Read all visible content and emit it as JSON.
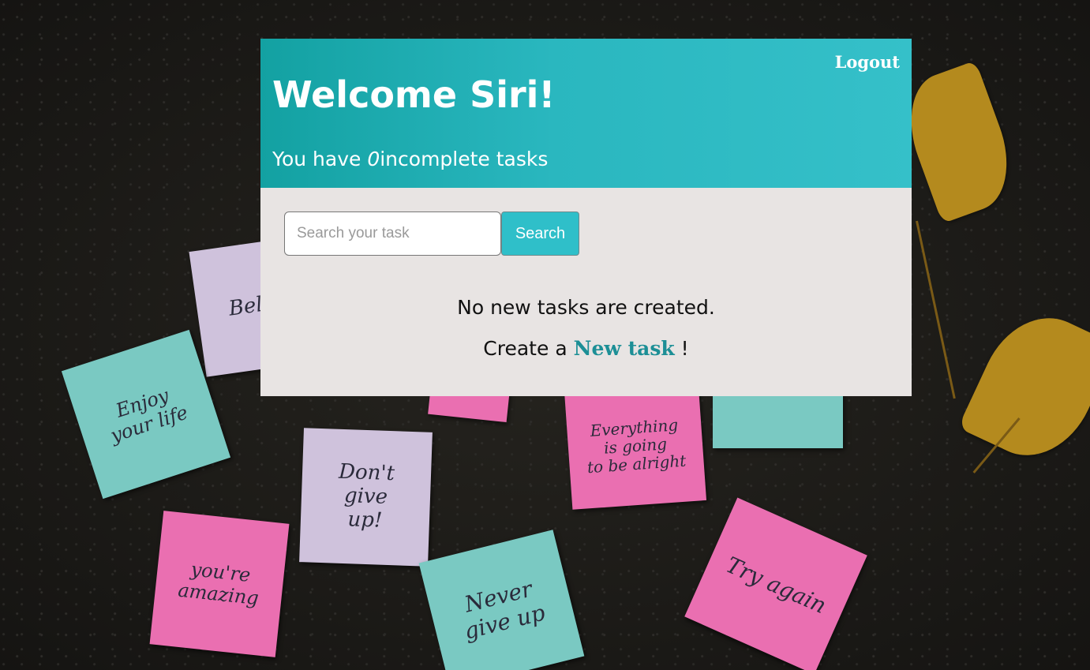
{
  "header": {
    "logout_label": "Logout",
    "welcome_title": "Welcome Siri!",
    "subtitle_prefix": "You have ",
    "incomplete_count": "0",
    "subtitle_suffix": "incomplete tasks"
  },
  "search": {
    "placeholder": "Search your task",
    "value": "",
    "button_label": "Search"
  },
  "empty_state": {
    "message": "No new tasks are created.",
    "create_prefix": "Create a ",
    "create_link_label": "New task",
    "create_suffix": " !"
  },
  "background_notes": [
    "Enjoy\nyour life",
    "Don't\ngive\nup!",
    "you're\namazing",
    "Never\ngive up",
    "Everything\nis going\nto be alright",
    "Try again",
    "Bel"
  ],
  "colors": {
    "header_start": "#13a1a2",
    "header_end": "#35c0c9",
    "card_background": "#e8e4e3",
    "link": "#1d8f96",
    "search_button": "#2fbfc9"
  }
}
